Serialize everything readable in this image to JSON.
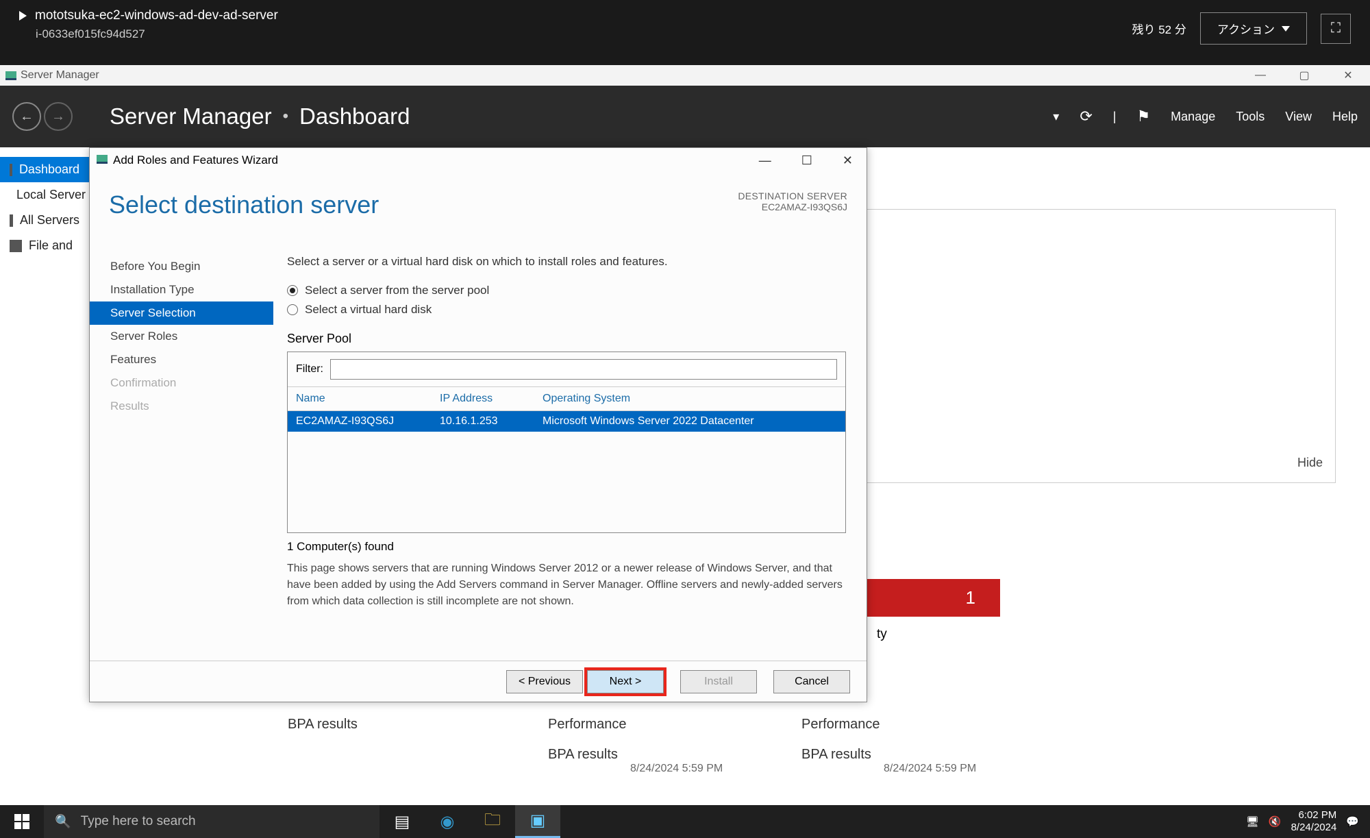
{
  "ec2": {
    "instance_name": "mototsuka-ec2-windows-ad-dev-ad-server",
    "instance_id": "i-0633ef015fc94d527",
    "remaining": "残り 52 分",
    "action_label": "アクション"
  },
  "rdp_title": "Server Manager",
  "sm": {
    "app_title": "Server Manager",
    "page": "Dashboard",
    "menu": {
      "manage": "Manage",
      "tools": "Tools",
      "view": "View",
      "help": "Help"
    },
    "sidebar": {
      "items": [
        {
          "label": "Dashboard"
        },
        {
          "label": "Local Server"
        },
        {
          "label": "All Servers"
        },
        {
          "label": "File and"
        }
      ]
    },
    "hide": "Hide",
    "tile_count": "1",
    "manageability": "ty",
    "col_a": {
      "l1": "BPA results"
    },
    "col_b": {
      "l1": "Performance",
      "l2": "BPA results"
    },
    "col_c": {
      "l1": "Performance",
      "l2": "BPA results"
    },
    "timestamp": "8/24/2024 5:59 PM"
  },
  "wizard": {
    "title": "Add Roles and Features Wizard",
    "heading": "Select destination server",
    "dest_label": "DESTINATION SERVER",
    "dest_value": "EC2AMAZ-I93QS6J",
    "steps": [
      {
        "label": "Before You Begin"
      },
      {
        "label": "Installation Type"
      },
      {
        "label": "Server Selection",
        "selected": true
      },
      {
        "label": "Server Roles"
      },
      {
        "label": "Features"
      },
      {
        "label": "Confirmation",
        "disabled": true
      },
      {
        "label": "Results",
        "disabled": true
      }
    ],
    "description": "Select a server or a virtual hard disk on which to install roles and features.",
    "radio1": "Select a server from the server pool",
    "radio2": "Select a virtual hard disk",
    "pool_label": "Server Pool",
    "filter_label": "Filter:",
    "columns": {
      "name": "Name",
      "ip": "IP Address",
      "os": "Operating System"
    },
    "rows": [
      {
        "name": "EC2AMAZ-I93QS6J",
        "ip": "10.16.1.253",
        "os": "Microsoft Windows Server 2022 Datacenter"
      }
    ],
    "found": "1 Computer(s) found",
    "note": "This page shows servers that are running Windows Server 2012 or a newer release of Windows Server, and that have been added by using the Add Servers command in Server Manager. Offline servers and newly-added servers from which data collection is still incomplete are not shown.",
    "buttons": {
      "previous": "< Previous",
      "next": "Next >",
      "install": "Install",
      "cancel": "Cancel"
    }
  },
  "taskbar": {
    "search_placeholder": "Type here to search",
    "time": "6:02 PM",
    "date": "8/24/2024"
  }
}
